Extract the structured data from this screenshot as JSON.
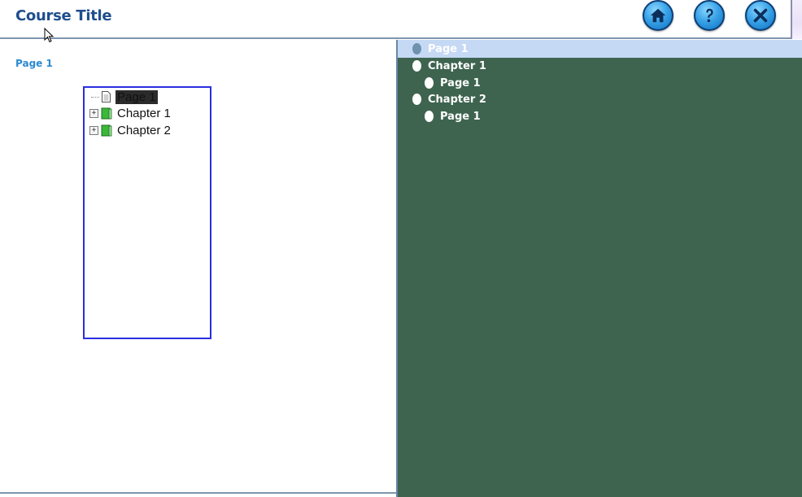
{
  "header": {
    "course_title": "Course Title",
    "buttons": [
      {
        "name": "home-button",
        "icon": "home-icon"
      },
      {
        "name": "help-button",
        "icon": "question-icon"
      },
      {
        "name": "close-button",
        "icon": "close-icon"
      }
    ]
  },
  "content": {
    "page_heading": "Page 1",
    "tree": [
      {
        "label": "Page 1",
        "type": "page",
        "selected": true
      },
      {
        "label": "Chapter 1",
        "type": "chapter",
        "expander": "+"
      },
      {
        "label": "Chapter 2",
        "type": "chapter",
        "expander": "+"
      }
    ]
  },
  "nav": {
    "items": [
      {
        "label": "Page 1",
        "level": 0,
        "active": true
      },
      {
        "label": "Chapter 1",
        "level": 0
      },
      {
        "label": "Page 1",
        "level": 1
      },
      {
        "label": "Chapter 2",
        "level": 0
      },
      {
        "label": "Page 1",
        "level": 1
      }
    ]
  },
  "colors": {
    "title": "#1f4e8c",
    "panel_bg": "#3e6450",
    "nav_selected_bg": "#c5d9f4",
    "tree_border": "#2a2fe0"
  }
}
